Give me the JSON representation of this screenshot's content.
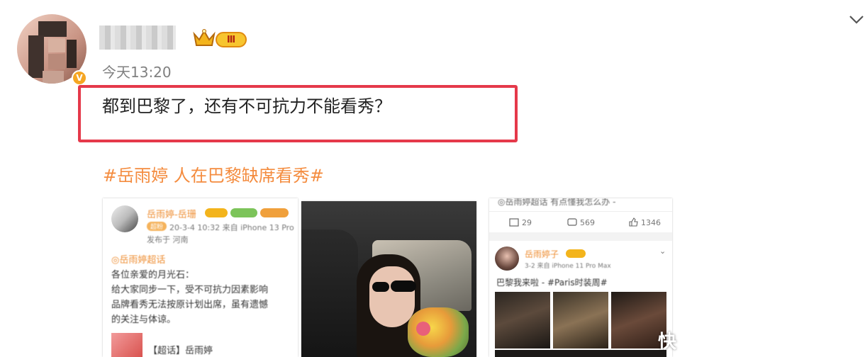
{
  "post": {
    "timestamp": "今天13:20",
    "level_badge": "Ⅲ",
    "verified_badge": "V",
    "text": "都到巴黎了，还有不可抗力不能看秀？",
    "hashtag": "#岳雨婷 人在巴黎缺席看秀#"
  },
  "image1": {
    "username": "岳雨婷-岳珊",
    "super_fan": "超粉",
    "meta": "20-3-4 10:32 来自 iPhone 13 Pro",
    "sub_meta": "发布于 河南",
    "topic": "◎岳雨婷超话",
    "greeting": "各位亲爱的月光石：",
    "body_lines": [
      "给大家同步一下，受不可抗力因素影响",
      "品牌看秀无法按原计划出席，虽有遗憾",
      "的关注与体谅。"
    ],
    "footer": "【超话】岳雨婷"
  },
  "image3": {
    "topic_line": "◎岳雨婷超话   有点懂我怎么办 -",
    "repost_count": "29",
    "comment_count": "569",
    "like_count": "1346",
    "username": "岳雨婷子",
    "meta": "3-2  来自 iPhone 11 Pro Max",
    "post_line": "巴黎我来啦 - #Paris时装周#"
  },
  "watermark": "快",
  "colors": {
    "highlight_border": "#e5394a",
    "hashtag": "#f48c3f",
    "level_badge_bg": "#f7c52f",
    "verified": "#f5a623"
  },
  "icons": [
    "chevron-down-icon",
    "crown-icon",
    "verified-icon",
    "repost-icon",
    "comment-icon",
    "like-icon"
  ]
}
